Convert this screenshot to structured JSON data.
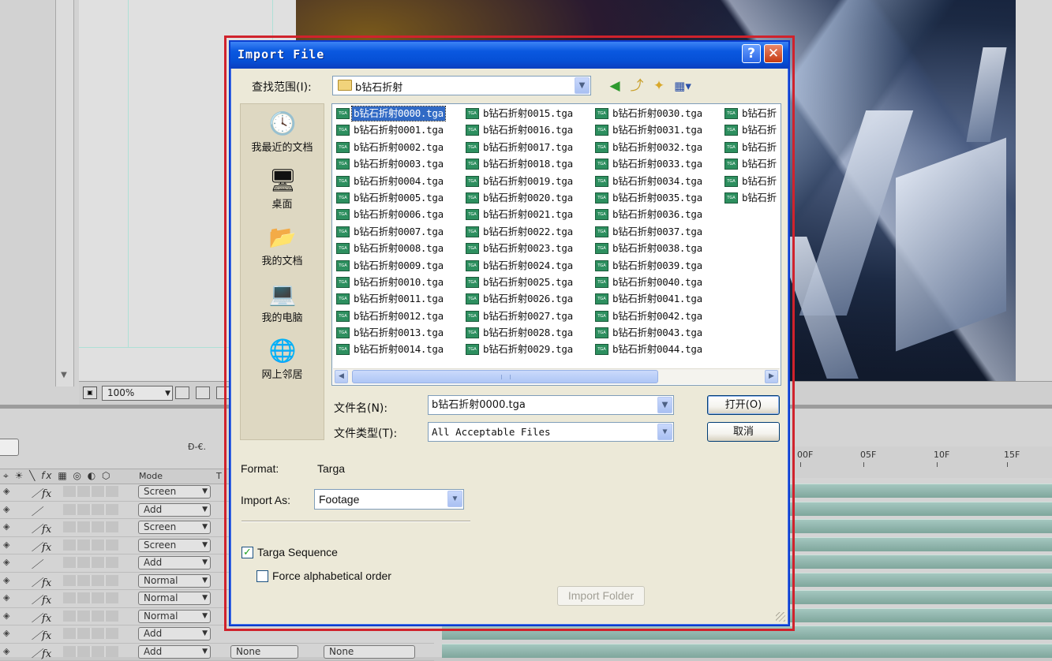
{
  "dialog": {
    "title": "Import File",
    "help_glyph": "?",
    "close_glyph": "✕",
    "look_in_label": "查找范围(I):",
    "look_in_value": "b钻石折射",
    "combo_arrow": "⌄",
    "places": [
      "我最近的文档",
      "桌面",
      "我的文档",
      "我的电脑",
      "网上邻居"
    ],
    "files_col1": [
      "b钻石折射0000.tga",
      "b钻石折射0001.tga",
      "b钻石折射0002.tga",
      "b钻石折射0003.tga",
      "b钻石折射0004.tga",
      "b钻石折射0005.tga",
      "b钻石折射0006.tga",
      "b钻石折射0007.tga",
      "b钻石折射0008.tga",
      "b钻石折射0009.tga",
      "b钻石折射0010.tga",
      "b钻石折射0011.tga",
      "b钻石折射0012.tga",
      "b钻石折射0013.tga",
      "b钻石折射0014.tga"
    ],
    "files_col2": [
      "b钻石折射0015.tga",
      "b钻石折射0016.tga",
      "b钻石折射0017.tga",
      "b钻石折射0018.tga",
      "b钻石折射0019.tga",
      "b钻石折射0020.tga",
      "b钻石折射0021.tga",
      "b钻石折射0022.tga",
      "b钻石折射0023.tga",
      "b钻石折射0024.tga",
      "b钻石折射0025.tga",
      "b钻石折射0026.tga",
      "b钻石折射0027.tga",
      "b钻石折射0028.tga",
      "b钻石折射0029.tga"
    ],
    "files_col3": [
      "b钻石折射0030.tga",
      "b钻石折射0031.tga",
      "b钻石折射0032.tga",
      "b钻石折射0033.tga",
      "b钻石折射0034.tga",
      "b钻石折射0035.tga",
      "b钻石折射0036.tga",
      "b钻石折射0037.tga",
      "b钻石折射0038.tga",
      "b钻石折射0039.tga",
      "b钻石折射0040.tga",
      "b钻石折射0041.tga",
      "b钻石折射0042.tga",
      "b钻石折射0043.tga",
      "b钻石折射0044.tga"
    ],
    "files_col4": [
      "b钻石折",
      "b钻石折",
      "b钻石折",
      "b钻石折",
      "b钻石折",
      "b钻石折"
    ],
    "selected_file": "b钻石折射0000.tga",
    "file_icon_text": "TGA",
    "file_name_label": "文件名(N):",
    "file_name_value": "b钻石折射0000.tga",
    "file_type_label": "文件类型(T):",
    "file_type_value": "All Acceptable Files",
    "open_button": "打开(O)",
    "cancel_button": "取消",
    "format_label": "Format:",
    "format_value": "Targa",
    "import_as_label": "Import As:",
    "import_as_value": "Footage",
    "targa_sequence_label": "Targa Sequence",
    "targa_sequence_checked": true,
    "force_alpha_label": "Force alphabetical order",
    "force_alpha_checked": false,
    "import_folder_button": "Import Folder"
  },
  "background": {
    "zoom_value": "100%",
    "timeline_mode_header": "Mode",
    "timeline_t_header": "T",
    "layer_modes": [
      "Screen",
      "Add",
      "Screen",
      "Screen",
      "Add",
      "Normal",
      "Normal",
      "Normal",
      "Add",
      "Add"
    ],
    "track_matte_values": [
      "None",
      "None"
    ],
    "ruler_ticks": [
      "00F",
      "05F",
      "10F",
      "15F"
    ],
    "switch_glyph": "Ð-€."
  }
}
